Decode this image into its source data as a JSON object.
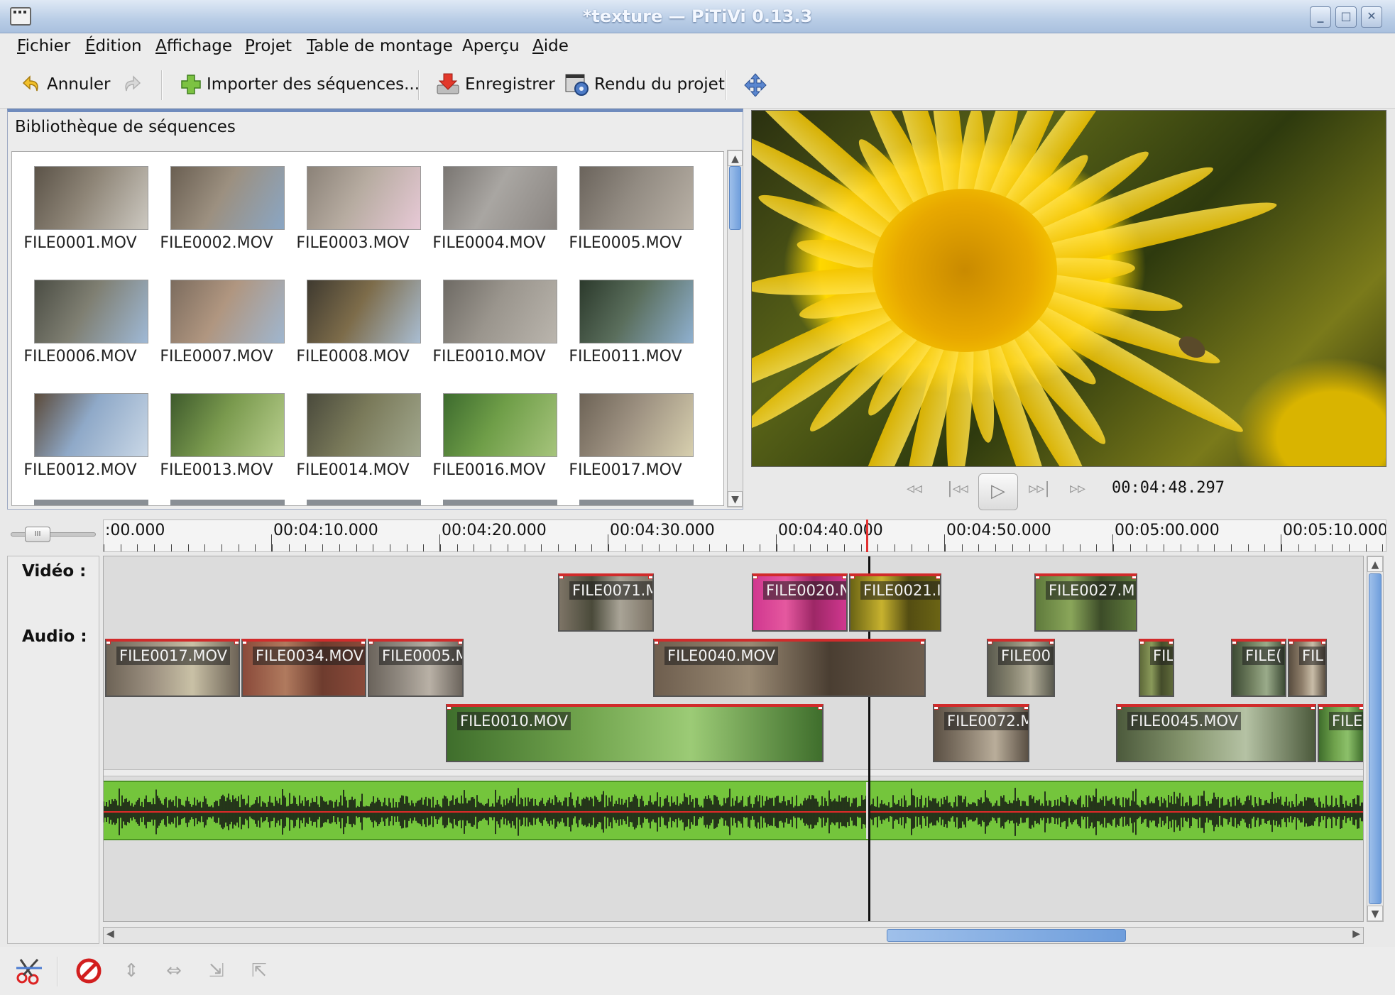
{
  "window": {
    "title": "*texture — PiTiVi 0.13.3",
    "minimize": "_",
    "maximize": "□",
    "close": "✕"
  },
  "menu": {
    "items": [
      {
        "first": "F",
        "rest": "ichier"
      },
      {
        "first": "É",
        "rest": "dition"
      },
      {
        "first": "A",
        "rest": "ffichage"
      },
      {
        "first": "P",
        "rest": "rojet"
      },
      {
        "first": "T",
        "rest": "able de montage"
      },
      {
        "first": "",
        "rest": "Aperçu"
      },
      {
        "first": "A",
        "rest": "ide"
      }
    ]
  },
  "toolbar": {
    "undo": "Annuler",
    "import": "Importer des séquences...",
    "save": "Enregistrer",
    "render": "Rendu du projet"
  },
  "library": {
    "title": "Bibliothèque de séquences",
    "items": [
      {
        "name": "FILE0001.MOV",
        "colors": [
          "#5b5348",
          "#8e8577",
          "#ccc8c0"
        ]
      },
      {
        "name": "FILE0002.MOV",
        "colors": [
          "#6a5f52",
          "#9c9080",
          "#8aa6c4"
        ]
      },
      {
        "name": "FILE0003.MOV",
        "colors": [
          "#8b8278",
          "#b7aca1",
          "#e7c9d6"
        ]
      },
      {
        "name": "FILE0004.MOV",
        "colors": [
          "#7a7672",
          "#a9a6a2",
          "#8a8581"
        ]
      },
      {
        "name": "FILE0005.MOV",
        "colors": [
          "#6b645c",
          "#928b82",
          "#b9b1a6"
        ]
      },
      {
        "name": "FILE0006.MOV",
        "colors": [
          "#4b4d44",
          "#7f7f72",
          "#9fb9d6"
        ]
      },
      {
        "name": "FILE0007.MOV",
        "colors": [
          "#7c6c5e",
          "#b09680",
          "#9fb6cf"
        ]
      },
      {
        "name": "FILE0008.MOV",
        "colors": [
          "#3f3a30",
          "#7d6c4a",
          "#a9bdd2"
        ]
      },
      {
        "name": "FILE0010.MOV",
        "colors": [
          "#6e6a64",
          "#9a958d",
          "#bab5ad"
        ]
      },
      {
        "name": "FILE0011.MOV",
        "colors": [
          "#2c3a2c",
          "#5a6e5c",
          "#8fb0cf"
        ]
      },
      {
        "name": "FILE0012.MOV",
        "colors": [
          "#5b4a3a",
          "#8fa9c8",
          "#c9d7e6"
        ]
      },
      {
        "name": "FILE0013.MOV",
        "colors": [
          "#3e5a2c",
          "#7a9a4e",
          "#b9cf8e"
        ]
      },
      {
        "name": "FILE0014.MOV",
        "colors": [
          "#4a4a3c",
          "#7a7a5a",
          "#a2a88e"
        ]
      },
      {
        "name": "FILE0016.MOV",
        "colors": [
          "#3d6b2e",
          "#6f9e48",
          "#a6c47c"
        ]
      },
      {
        "name": "FILE0017.MOV",
        "colors": [
          "#6d6356",
          "#9d9181",
          "#d7cfae"
        ]
      }
    ]
  },
  "viewer": {
    "timecode": "00:04:48.297"
  },
  "transport": {
    "rewind": "◃◃",
    "prev": "|◃◃",
    "play": "▷",
    "next": "▹▹|",
    "forward": "▹▹"
  },
  "ruler": {
    "labels": [
      ":00.000",
      "00:04:10.000",
      "00:04:20.000",
      "00:04:30.000",
      "00:04:40.000",
      "00:04:50.000",
      "00:05:00.000",
      "00:05:10.000"
    ]
  },
  "tracks": {
    "video_label": "Vidéo :",
    "audio_label": "Audio :",
    "clips_row1": [
      {
        "name": "FILE0071.M",
        "colors": [
          "#7d7466",
          "#4a4a3a",
          "#a9a497"
        ]
      },
      {
        "name": "FILE0020.N",
        "colors": [
          "#d0378f",
          "#e5589f",
          "#9d2766"
        ]
      },
      {
        "name": "FILE0021.I",
        "colors": [
          "#6b6414",
          "#c7b22e",
          "#544d12"
        ]
      },
      {
        "name": "FILE0027.M",
        "colors": [
          "#5f7a3c",
          "#8aa65a",
          "#3c4c28"
        ]
      }
    ],
    "clips_row2": [
      {
        "name": "FILE0017.MOV",
        "colors": [
          "#6d6356",
          "#9d9181",
          "#c9c1a6"
        ]
      },
      {
        "name": "FILE0034.MOV",
        "colors": [
          "#8a4a3a",
          "#b07a5e",
          "#6e3c2e"
        ]
      },
      {
        "name": "FILE0005.M",
        "colors": [
          "#6b645c",
          "#928b82",
          "#b9b1a6"
        ]
      },
      {
        "name": "FILE0040.MOV",
        "colors": [
          "#6e5e4e",
          "#9a8a74",
          "#4a3e32"
        ]
      },
      {
        "name": "FILE00",
        "colors": [
          "#5a5a4e",
          "#86836f",
          "#b2ad98"
        ]
      },
      {
        "name": "FIL",
        "colors": [
          "#5f6a3a",
          "#8a9a5a",
          "#444c2a"
        ]
      },
      {
        "name": "FILE(",
        "colors": [
          "#3c4a34",
          "#6f7e5e",
          "#9aab8a"
        ]
      },
      {
        "name": "FIL",
        "colors": [
          "#5a4e40",
          "#8e7e6a",
          "#c9bda8"
        ]
      }
    ],
    "clips_row3": [
      {
        "name": "FILE0010.MOV",
        "colors": [
          "#3f6e2c",
          "#6fa24c",
          "#9ccb76"
        ]
      },
      {
        "name": "FILE0072.M",
        "colors": [
          "#5b5044",
          "#8c8070",
          "#b9ad9a"
        ]
      },
      {
        "name": "FILE0045.MOV",
        "colors": [
          "#4c5a3c",
          "#86966e",
          "#b5c2a4"
        ]
      },
      {
        "name": "FILE(",
        "colors": [
          "#3f6e2c",
          "#6fa24c",
          "#8cc06a"
        ]
      }
    ]
  },
  "colors": {
    "audio_bg": "#74c53c",
    "clip_border": "#d12b2b",
    "playhead": "#111111"
  }
}
